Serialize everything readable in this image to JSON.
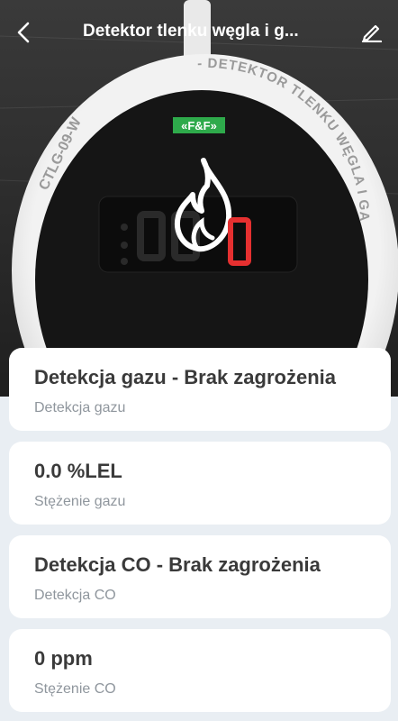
{
  "header": {
    "title": "Detektor tlenku węgla i g..."
  },
  "device": {
    "ring_text_left": "CTLG-09-W",
    "ring_text_top": "- DETEKTOR TLENKU WĘGLA I GAZU",
    "logo": "«F&F»",
    "display_digit": "0",
    "icon": "flame-icon"
  },
  "cards": [
    {
      "value": "Detekcja gazu - Brak zagrożenia",
      "label": "Detekcja gazu"
    },
    {
      "value": "0.0 %LEL",
      "label": "Stężenie gazu"
    },
    {
      "value": "Detekcja CO - Brak zagrożenia",
      "label": "Detekcja CO"
    },
    {
      "value": "0 ppm",
      "label": "Stężenie CO"
    }
  ],
  "colors": {
    "accent_logo": "#2eaa4b",
    "display_red": "#e53030",
    "card_bg": "#ffffff",
    "page_bg": "#e9eef3"
  }
}
